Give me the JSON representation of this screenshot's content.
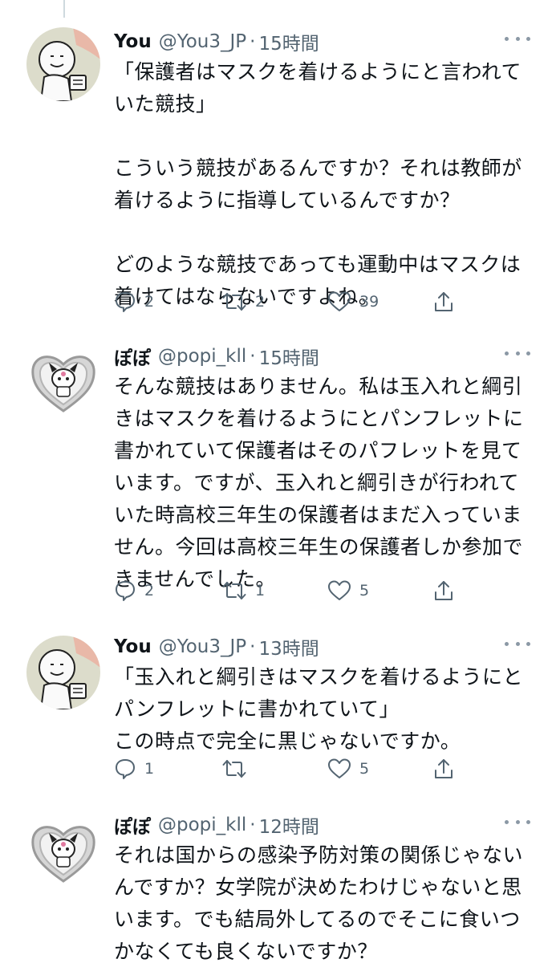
{
  "tweets": [
    {
      "name": "You",
      "handle": "@You3_JP",
      "time": "15時間",
      "text": "「保護者はマスクを着けるようにと言われていた競技」\n\nこういう競技があるんですか？それは教師が着けるように指導しているんですか？\n\nどのような競技であっても運動中はマスクは着けてはならないですよね。",
      "reply_count": "2",
      "retweet_count": "2",
      "like_count": "39",
      "avatar": "you-avatar"
    },
    {
      "name": "ぽぽ",
      "handle": "@popi_kll",
      "time": "15時間",
      "text": "そんな競技はありません。私は玉入れと綱引きはマスクを着けるようにとパンフレットに書かれていて保護者はそのパフレットを見ています。ですが、玉入れと綱引きが行われていた時高校三年生の保護者はまだ入っていません。今回は高校三年生の保護者しか参加できませんでした。",
      "reply_count": "2",
      "retweet_count": "1",
      "like_count": "5",
      "avatar": "popo-avatar"
    },
    {
      "name": "You",
      "handle": "@You3_JP",
      "time": "13時間",
      "text": "「玉入れと綱引きはマスクを着けるようにとパンフレットに書かれていて」\nこの時点で完全に黒じゃないですか。",
      "reply_count": "1",
      "retweet_count": "",
      "like_count": "5",
      "avatar": "you-avatar"
    },
    {
      "name": "ぽぽ",
      "handle": "@popi_kll",
      "time": "12時間",
      "text": "それは国からの感染予防対策の関係じゃないんですか？女学院が決めたわけじゃないと思います。でも結局外してるのでそこに食いつかなくても良くないですか？",
      "reply_count": "",
      "retweet_count": "",
      "like_count": "",
      "avatar": "popo-avatar"
    }
  ],
  "separator": "·",
  "colors": {
    "text": "#0f1419",
    "secondary": "#536471",
    "thread_line": "#cfd9de"
  },
  "icons": [
    "reply-icon",
    "retweet-icon",
    "like-icon",
    "share-icon",
    "more-icon"
  ]
}
